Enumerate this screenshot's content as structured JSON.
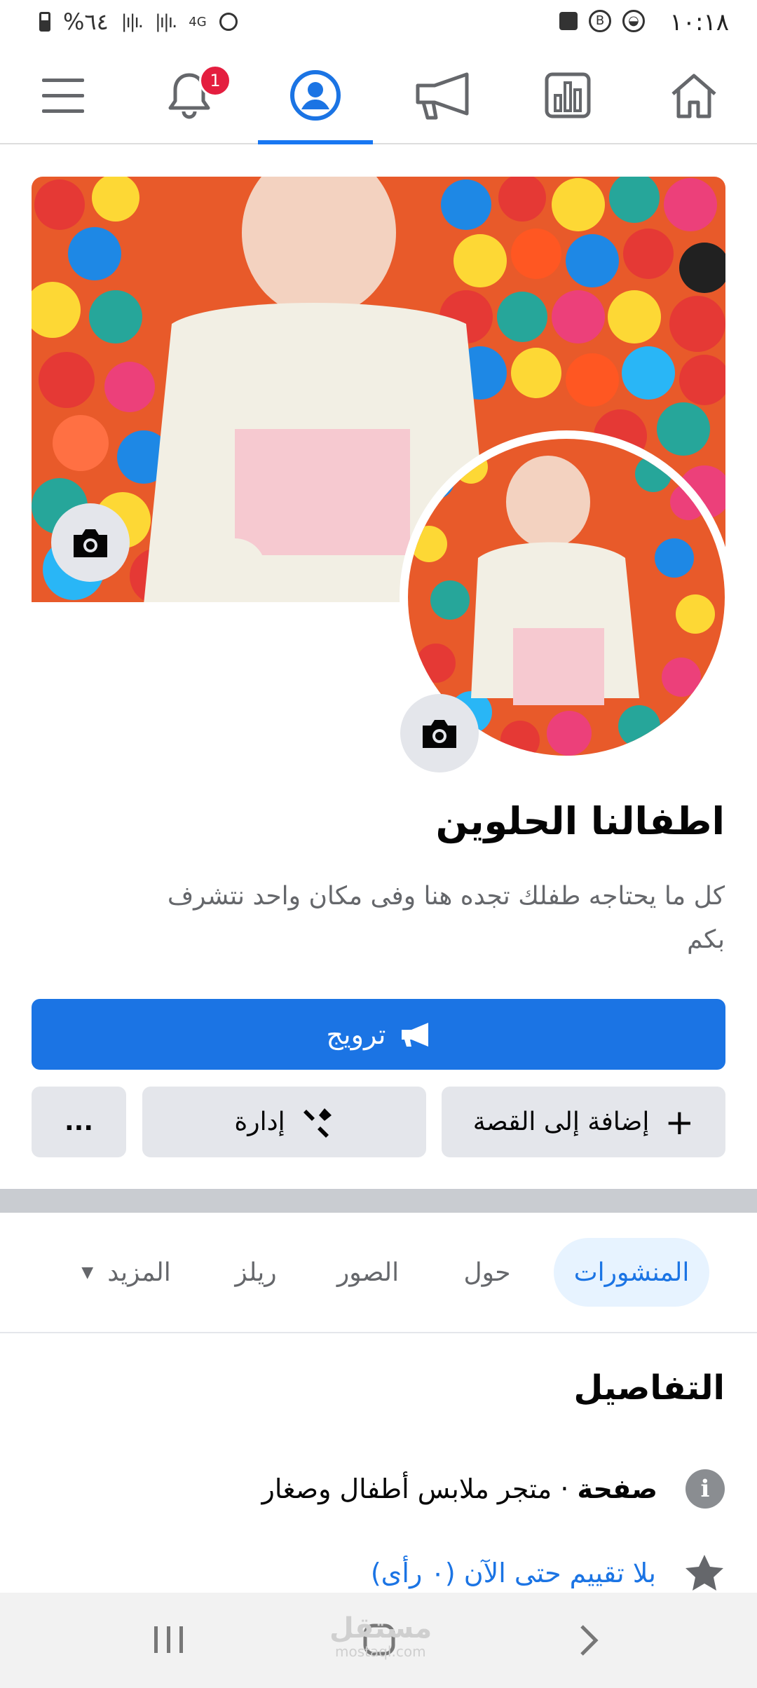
{
  "status_bar": {
    "time": "١٠:١٨",
    "battery": "%٦٤",
    "network": "4G"
  },
  "nav": {
    "notification_count": "1",
    "active_tab": "profile"
  },
  "page": {
    "title": "اطفالنا الحلوين",
    "bio": "كل ما يحتاجه طفلك تجده هنا وفى مكان واحد نتشرف بكم"
  },
  "actions": {
    "promote_label": "ترويج",
    "manage_label": "إدارة",
    "add_story_label": "إضافة إلى القصة",
    "more_label": "..."
  },
  "tabs": {
    "posts": "المنشورات",
    "about": "حول",
    "photos": "الصور",
    "reels": "ريلز",
    "more": "المزيد"
  },
  "details": {
    "title": "التفاصيل",
    "category_prefix": "صفحة",
    "category_text": " · متجر ملابس أطفال وصغار",
    "rating_text": "بلا تقييم حتى الآن (٠ رأى)"
  },
  "watermark": {
    "brand": "مستقل",
    "url": "mostaql.com"
  },
  "colors": {
    "accent": "#1b74e4",
    "badge": "#e41e3f",
    "active_tab_bg": "#e7f3ff"
  }
}
